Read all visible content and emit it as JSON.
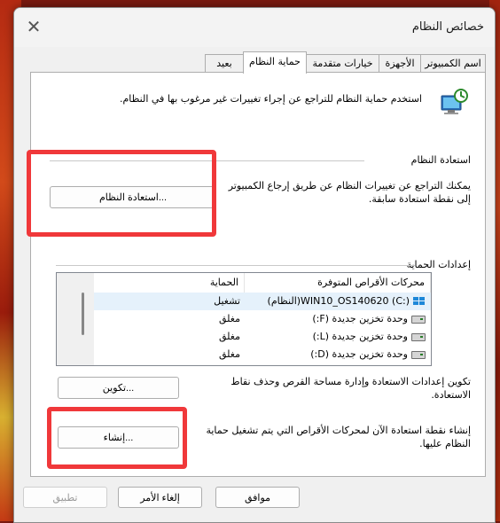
{
  "window": {
    "title": "خصائص النظام",
    "close_glyph": "✕"
  },
  "tabs": [
    {
      "label": "اسم الكمبيوتر"
    },
    {
      "label": "الأجهزة"
    },
    {
      "label": "خيارات متقدمة"
    },
    {
      "label": "حماية النظام"
    },
    {
      "label": "بعيد"
    }
  ],
  "intro": {
    "text": "استخدم حماية النظام للتراجع عن إجراء تغييرات غير مرغوب بها في النظام.",
    "icon": "system-protection-icon"
  },
  "restore": {
    "heading": "استعادة النظام",
    "description": "يمكنك التراجع عن تغييرات النظام عن طريق إرجاع الكمبيوتر إلى نقطة استعادة سابقة.",
    "button": "استعادة النظام..."
  },
  "protection": {
    "heading": "إعدادات الحماية",
    "columns": {
      "drives": "محركات الأقراص المتوفرة",
      "protection": "الحماية"
    },
    "rows": [
      {
        "drive": "WIN10_OS140620 (C:)(النظام)",
        "status": "تشغيل",
        "icon": "windows-drive-icon"
      },
      {
        "drive": "وحدة تخزين جديدة (F:)",
        "status": "مغلق",
        "icon": "drive-icon"
      },
      {
        "drive": "وحدة تخزين جديدة (L:)",
        "status": "مغلق",
        "icon": "drive-icon"
      },
      {
        "drive": "وحدة تخزين جديدة (D:)",
        "status": "مغلق",
        "icon": "drive-icon"
      }
    ]
  },
  "configure": {
    "description": "تكوين إعدادات الاستعادة وإدارة مساحة القرص وحذف نقاط الاستعادة.",
    "button": "تكوين..."
  },
  "create": {
    "description": "إنشاء نقطة استعادة الآن لمحركات الأقراص التي يتم تشغيل حماية النظام عليها.",
    "button": "إنشاء..."
  },
  "footer": {
    "ok": "موافق",
    "cancel": "إلغاء الأمر",
    "apply": "تطبيق"
  },
  "colors": {
    "highlight": "#f0383a",
    "selection": "#e5f1fb"
  }
}
